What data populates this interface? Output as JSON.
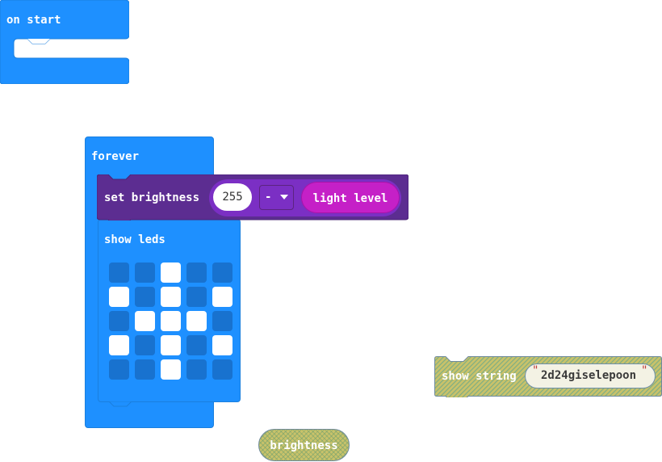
{
  "colors": {
    "basic": "#1e90ff",
    "basic_border": "#1b7fde",
    "display_purple": "#5c2d91",
    "dropdown_purple": "#7b2fc4",
    "input_magenta": "#c520c7",
    "disabled_hatch": "#c9c26a",
    "led_off": "#1872cf",
    "led_on": "#ffffff"
  },
  "on_start": {
    "label": "on start"
  },
  "forever": {
    "label": "forever"
  },
  "set_brightness": {
    "label": "set brightness",
    "value": "255",
    "operator": "-",
    "sensor": "light level"
  },
  "show_leds": {
    "label": "show leds",
    "grid": [
      [
        0,
        0,
        1,
        0,
        0
      ],
      [
        1,
        0,
        1,
        0,
        1
      ],
      [
        0,
        1,
        1,
        1,
        0
      ],
      [
        1,
        0,
        1,
        0,
        1
      ],
      [
        0,
        0,
        1,
        0,
        0
      ]
    ]
  },
  "show_string": {
    "label": "show string",
    "open_quote": "\"",
    "value": "2d24giselepoon",
    "close_quote": "\""
  },
  "brightness_reporter": {
    "label": "brightness"
  }
}
